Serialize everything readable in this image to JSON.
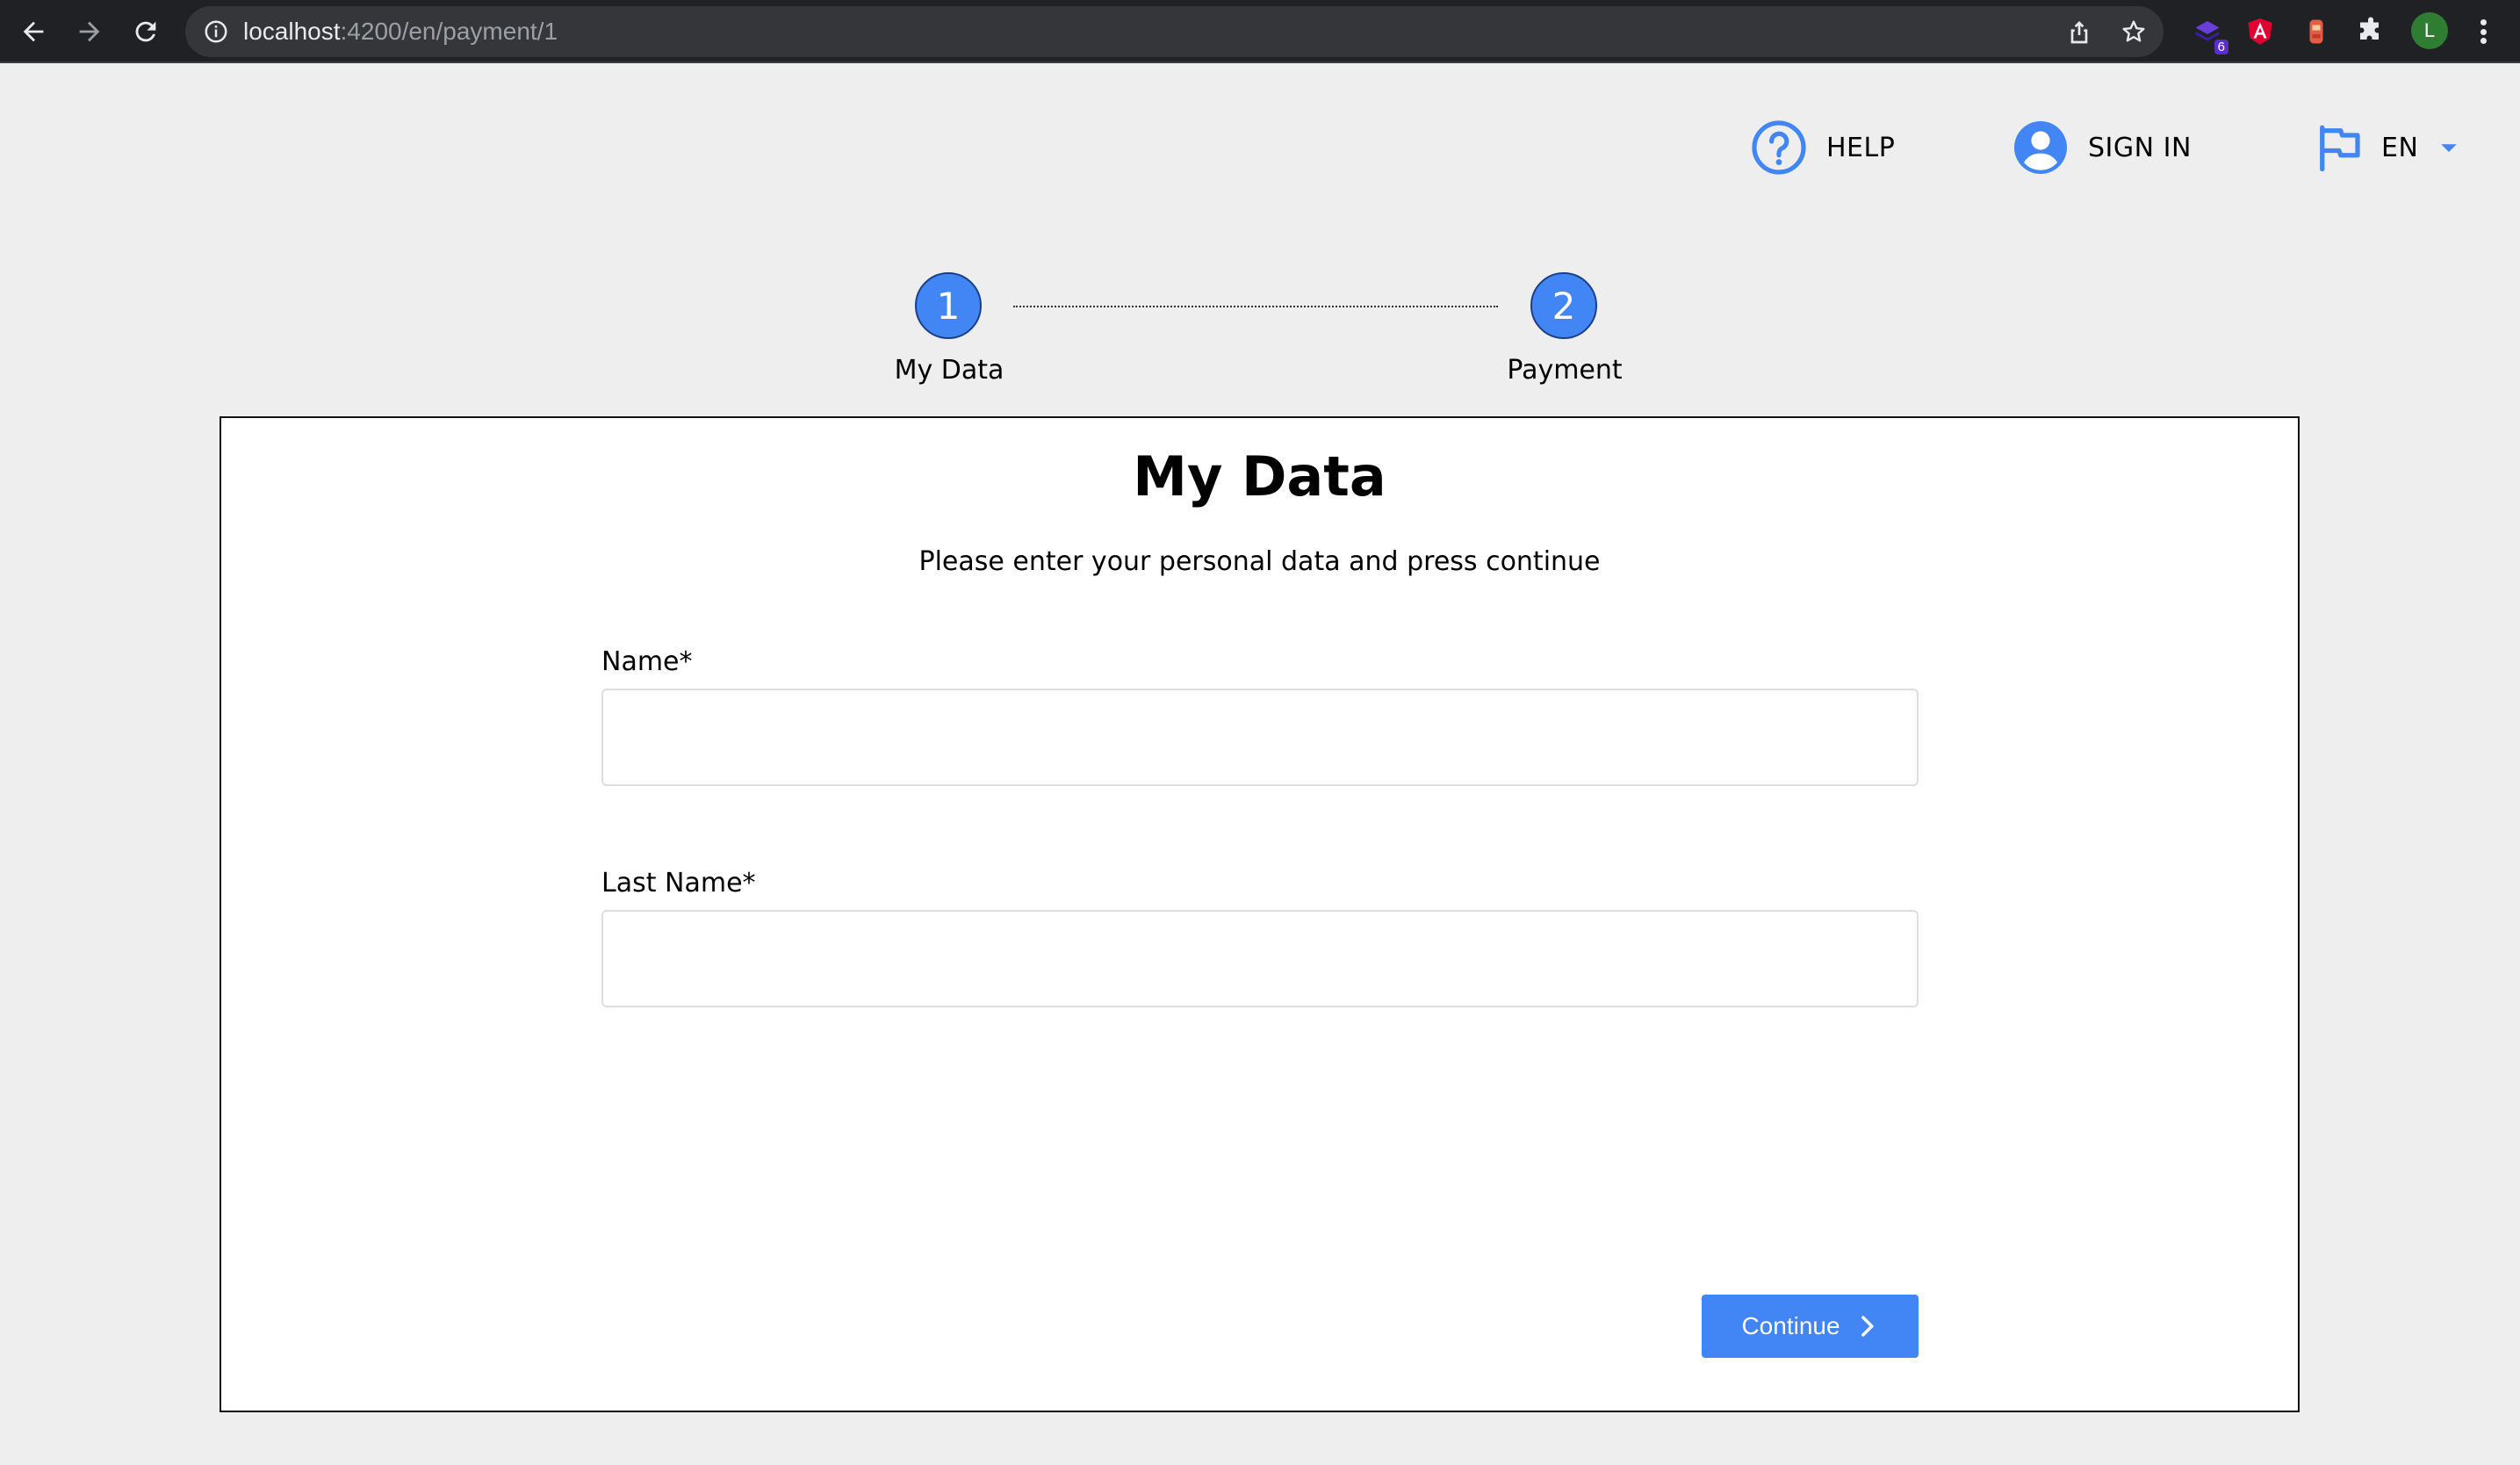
{
  "browser": {
    "url_host": "localhost",
    "url_path": ":4200/en/payment/1",
    "extension_badge": "6",
    "profile_initial": "L"
  },
  "header": {
    "help_label": "HELP",
    "sign_in_label": "SIGN IN",
    "language_label": "EN",
    "accent_color": "#4285f4"
  },
  "stepper": {
    "steps": [
      {
        "number": "1",
        "label": "My Data"
      },
      {
        "number": "2",
        "label": "Payment"
      }
    ]
  },
  "form": {
    "title": "My Data",
    "subtitle": "Please enter your personal data and press continue",
    "name_label": "Name*",
    "name_value": "",
    "last_name_label": "Last Name*",
    "last_name_value": "",
    "continue_label": "Continue"
  }
}
